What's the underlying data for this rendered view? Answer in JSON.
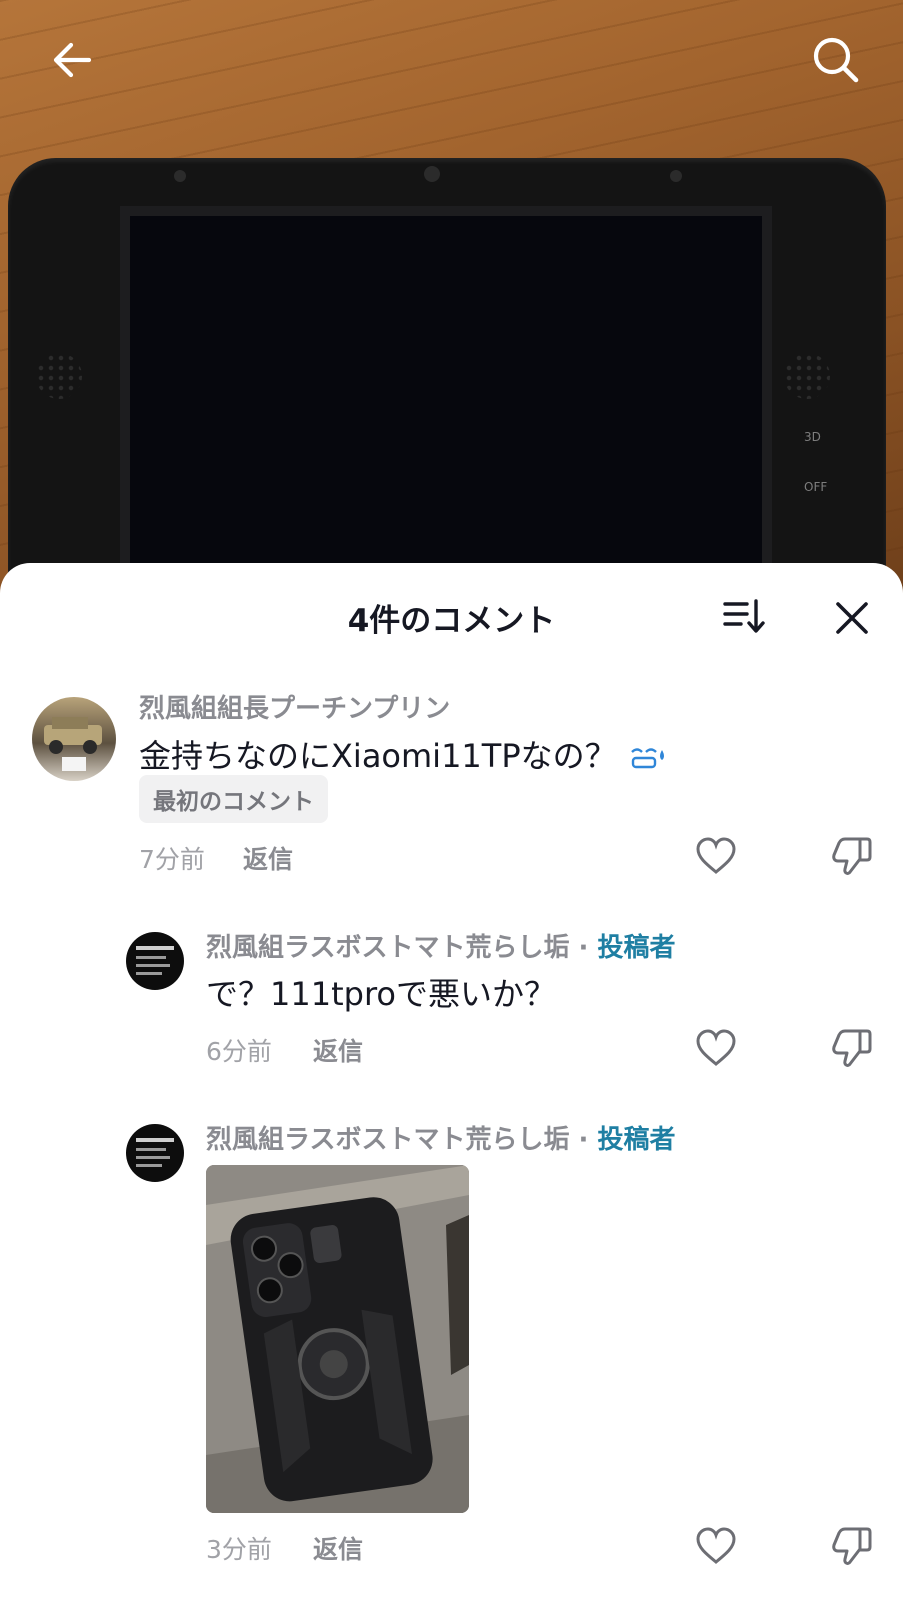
{
  "comments_panel": {
    "title": "4件のコメント"
  },
  "comments": [
    {
      "username": "烈風組組長プーチンプリン",
      "text": "金持ちなのにXiaomi11TPなの？",
      "badge": "最初のコメント",
      "time": "7分前",
      "reply_label": "返信"
    },
    {
      "username": "烈風組ラスボストマト荒らし垢",
      "separator": " · ",
      "author_label": "投稿者",
      "text": "で？111tproで悪いか？",
      "time": "6分前",
      "reply_label": "返信"
    },
    {
      "username": "烈風組ラスボストマト荒らし垢",
      "separator": " · ",
      "author_label": "投稿者",
      "time": "3分前",
      "reply_label": "返信"
    }
  ],
  "device_labels": {
    "mode_3d": "3D",
    "mode_off": "OFF"
  },
  "colors": {
    "author_accent": "#1f7fa3",
    "secondary_text": "#8a8b91",
    "primary_text": "#161823"
  },
  "icons": [
    "back-arrow-icon",
    "search-icon",
    "sort-icon",
    "close-icon",
    "heart-icon",
    "dislike-icon",
    "sweat-emoji-icon"
  ]
}
